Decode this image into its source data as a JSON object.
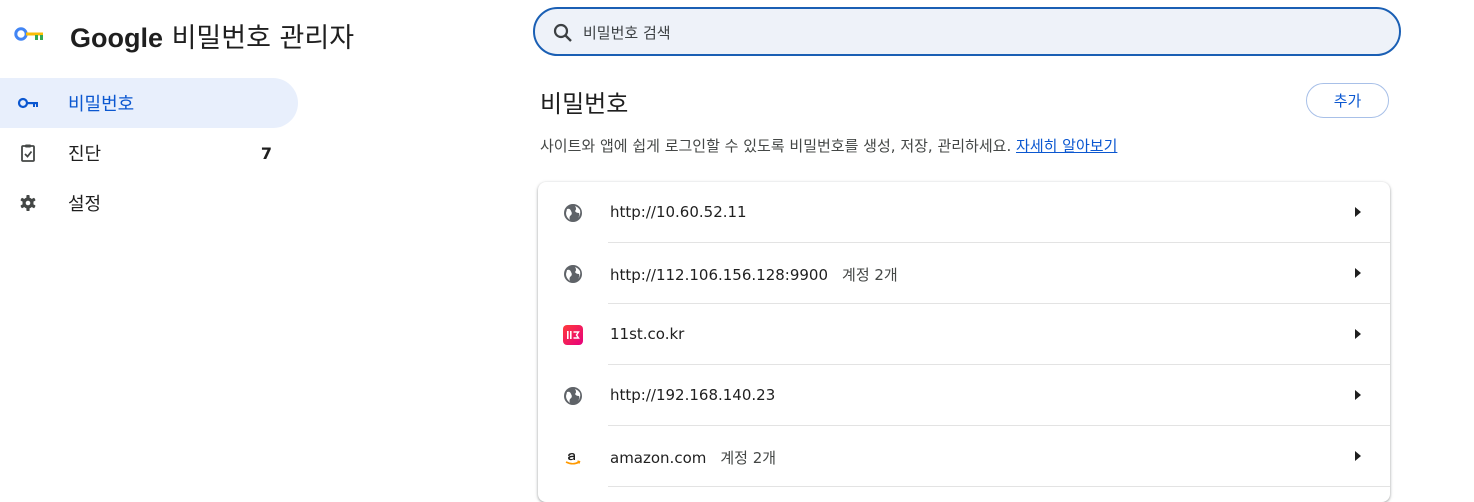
{
  "app": {
    "brand": "Google",
    "title_suffix": "비밀번호 관리자"
  },
  "nav": {
    "items": [
      {
        "label": "비밀번호",
        "icon": "key-icon",
        "active": true
      },
      {
        "label": "진단",
        "icon": "clipboard-check-icon",
        "count": "7"
      },
      {
        "label": "설정",
        "icon": "gear-icon"
      }
    ]
  },
  "search": {
    "placeholder": "비밀번호 검색",
    "value": ""
  },
  "main": {
    "title": "비밀번호",
    "add_label": "추가",
    "description": "사이트와 앱에 쉽게 로그인할 수 있도록 비밀번호를 생성, 저장, 관리하세요.",
    "learn_more": "자세히 알아보기"
  },
  "passwords": [
    {
      "site": "http://10.60.52.11",
      "accounts": "",
      "icon": "globe-icon"
    },
    {
      "site": "http://112.106.156.128:9900",
      "accounts": "계정 2개",
      "icon": "globe-icon"
    },
    {
      "site": "11st.co.kr",
      "accounts": "",
      "icon": "11st-icon"
    },
    {
      "site": "http://192.168.140.23",
      "accounts": "",
      "icon": "globe-icon"
    },
    {
      "site": "amazon.com",
      "accounts": "계정 2개",
      "icon": "amazon-icon"
    }
  ],
  "colors": {
    "accent": "#0b57d0",
    "active_bg": "#e8effc",
    "search_bg": "#eef2f9",
    "search_border": "#1a5fb4"
  }
}
